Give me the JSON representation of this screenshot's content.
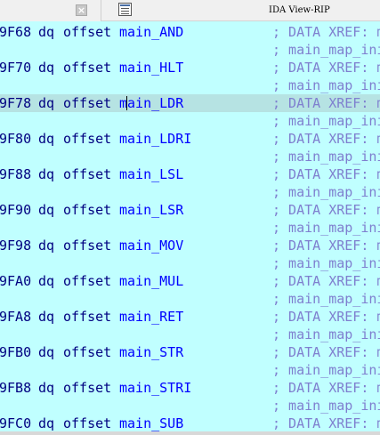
{
  "tabs": {
    "close_symbol": "×",
    "active_title": "IDA View-RIP"
  },
  "listing": {
    "rows": [
      {
        "kind": "code",
        "addr": "9F68",
        "mnem": "dq",
        "op": "offset",
        "sym": "main_AND",
        "cmt": "; DATA XREF: m"
      },
      {
        "kind": "xref",
        "cmt": "; main_map_ini"
      },
      {
        "kind": "code",
        "addr": "9F70",
        "mnem": "dq",
        "op": "offset",
        "sym": "main_HLT",
        "cmt": "; DATA XREF: m"
      },
      {
        "kind": "xref",
        "cmt": "; main_map_ini"
      },
      {
        "kind": "code",
        "addr": "9F78",
        "mnem": "dq",
        "op": "offset",
        "sym": "main_LDR",
        "cmt": "; DATA XREF: m",
        "highlight": true
      },
      {
        "kind": "xref",
        "cmt": "; main_map_ini"
      },
      {
        "kind": "code",
        "addr": "9F80",
        "mnem": "dq",
        "op": "offset",
        "sym": "main_LDRI",
        "cmt": "; DATA XREF: m"
      },
      {
        "kind": "xref",
        "cmt": "; main_map_ini"
      },
      {
        "kind": "code",
        "addr": "9F88",
        "mnem": "dq",
        "op": "offset",
        "sym": "main_LSL",
        "cmt": "; DATA XREF: m"
      },
      {
        "kind": "xref",
        "cmt": "; main_map_ini"
      },
      {
        "kind": "code",
        "addr": "9F90",
        "mnem": "dq",
        "op": "offset",
        "sym": "main_LSR",
        "cmt": "; DATA XREF: m"
      },
      {
        "kind": "xref",
        "cmt": "; main_map_ini"
      },
      {
        "kind": "code",
        "addr": "9F98",
        "mnem": "dq",
        "op": "offset",
        "sym": "main_MOV",
        "cmt": "; DATA XREF: m"
      },
      {
        "kind": "xref",
        "cmt": "; main_map_ini"
      },
      {
        "kind": "code",
        "addr": "9FA0",
        "mnem": "dq",
        "op": "offset",
        "sym": "main_MUL",
        "cmt": "; DATA XREF: m"
      },
      {
        "kind": "xref",
        "cmt": "; main_map_ini"
      },
      {
        "kind": "code",
        "addr": "9FA8",
        "mnem": "dq",
        "op": "offset",
        "sym": "main_RET",
        "cmt": "; DATA XREF: m"
      },
      {
        "kind": "xref",
        "cmt": "; main_map_ini"
      },
      {
        "kind": "code",
        "addr": "9FB0",
        "mnem": "dq",
        "op": "offset",
        "sym": "main_STR",
        "cmt": "; DATA XREF: m"
      },
      {
        "kind": "xref",
        "cmt": "; main_map_ini"
      },
      {
        "kind": "code",
        "addr": "9FB8",
        "mnem": "dq",
        "op": "offset",
        "sym": "main_STRI",
        "cmt": "; DATA XREF: m"
      },
      {
        "kind": "xref",
        "cmt": "; main_map_ini"
      },
      {
        "kind": "code",
        "addr": "9FC0",
        "mnem": "dq",
        "op": "offset",
        "sym": "main_SUB",
        "cmt": "; DATA XREF: m"
      }
    ]
  },
  "colors": {
    "background": "#c0ffff",
    "highlight_row": "#b6e3e3",
    "address": "#000080",
    "symbol": "#0000ff",
    "comment": "#7f7fcf"
  }
}
